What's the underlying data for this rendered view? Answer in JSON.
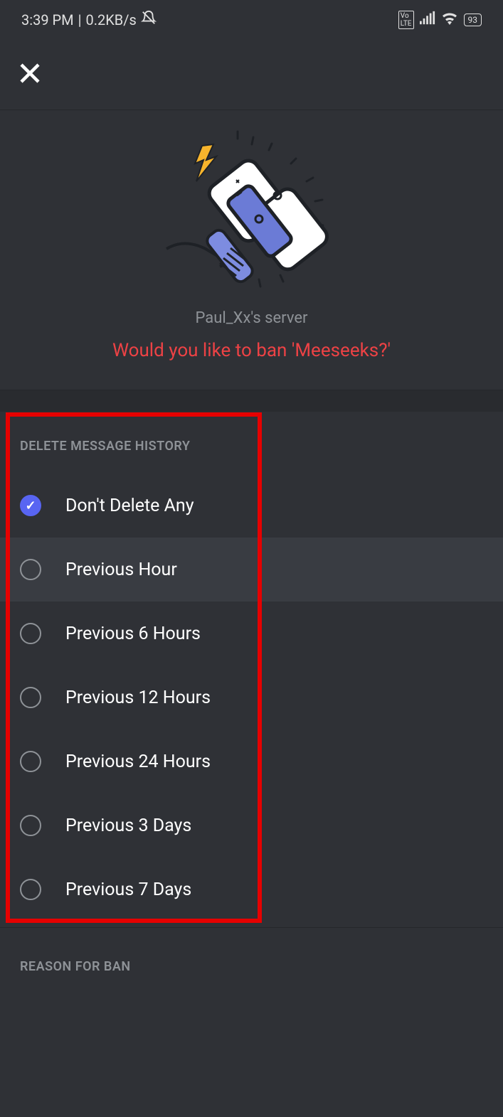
{
  "status_bar": {
    "time": "3:39 PM",
    "separator": "|",
    "data_rate": "0.2KB/s",
    "battery": "93"
  },
  "hero": {
    "server_name": "Paul_Xx's server",
    "question": "Would you like to ban 'Meeseeks?'"
  },
  "delete_history": {
    "title": "DELETE MESSAGE HISTORY",
    "options": [
      {
        "label": "Don't Delete Any",
        "selected": true
      },
      {
        "label": "Previous Hour",
        "selected": false,
        "hover": true
      },
      {
        "label": "Previous 6 Hours",
        "selected": false
      },
      {
        "label": "Previous 12 Hours",
        "selected": false
      },
      {
        "label": "Previous 24 Hours",
        "selected": false
      },
      {
        "label": "Previous 3 Days",
        "selected": false
      },
      {
        "label": "Previous 7 Days",
        "selected": false
      }
    ]
  },
  "reason": {
    "title": "REASON FOR BAN"
  }
}
